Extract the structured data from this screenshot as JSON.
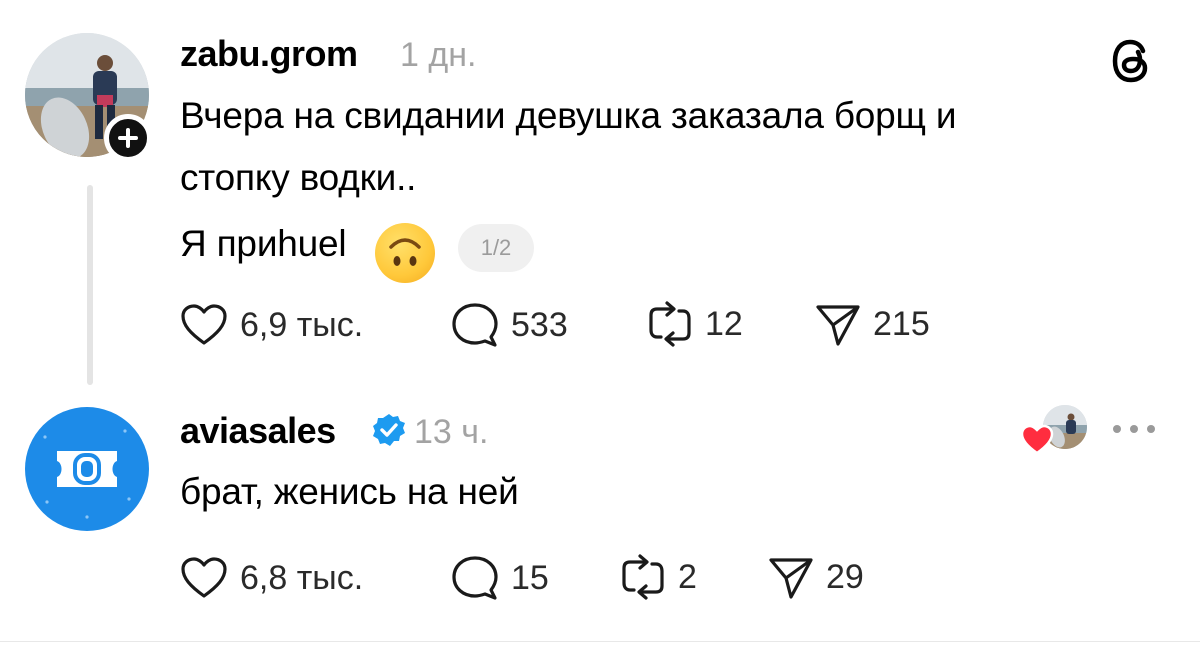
{
  "post": {
    "username": "zabu.grom",
    "time": "1 дн.",
    "text_line1": "Вчера на свидании девушка заказала борщ и",
    "text_line2": "стопку водки..",
    "text_line3": "Я приhuel",
    "emoji": "upside-down-face",
    "page_indicator": "1/2",
    "likes": "6,9 тыс.",
    "replies": "533",
    "reposts": "12",
    "shares": "215"
  },
  "reply": {
    "username": "aviasales",
    "verified": true,
    "time": "13 ч.",
    "text": "брат, женись на ней",
    "likes": "6,8 тыс.",
    "replies": "15",
    "reposts": "2",
    "shares": "29"
  },
  "icons": {
    "app_logo": "threads-logo-icon",
    "like": "heart-outline-icon",
    "reply": "speech-bubble-icon",
    "repost": "repost-arrows-icon",
    "share": "paper-plane-icon",
    "more": "more-dots-icon",
    "follow": "plus-icon"
  },
  "colors": {
    "verified_blue": "#1d9bf0",
    "aviasales_blue": "#1d8be8",
    "liked_red": "#ff2d3f",
    "muted_text": "#a3a3a3"
  }
}
